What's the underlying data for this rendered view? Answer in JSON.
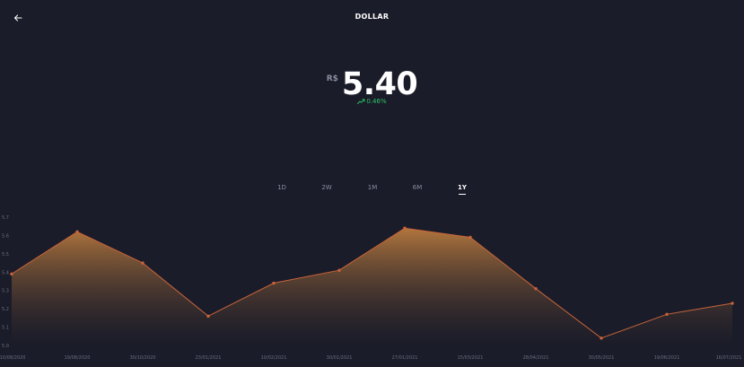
{
  "header": {
    "title": "DOLLAR",
    "back_icon": "arrow-left-icon"
  },
  "quote": {
    "currency": "R$",
    "price": "5.40",
    "change": "0.46%",
    "change_icon": "trend-up-icon",
    "change_color": "#29c466"
  },
  "ranges": [
    {
      "label": "1D",
      "active": false
    },
    {
      "label": "2W",
      "active": false
    },
    {
      "label": "1M",
      "active": false
    },
    {
      "label": "6M",
      "active": false
    },
    {
      "label": "1Y",
      "active": true
    }
  ],
  "chart_data": {
    "type": "area",
    "x": [
      "10/08/2020",
      "19/08/2020",
      "30/10/2020",
      "23/01/2021",
      "10/02/2021",
      "30/01/2021",
      "27/01/2021",
      "15/03/2021",
      "28/04/2021",
      "30/05/2021",
      "19/06/2021",
      "16/07/2021"
    ],
    "values": [
      5.39,
      5.62,
      5.45,
      5.16,
      5.34,
      5.41,
      5.64,
      5.59,
      5.31,
      5.04,
      5.17,
      5.23
    ],
    "ylim": [
      5.0,
      5.7
    ],
    "y_ticks": [
      "5.0",
      "5.1",
      "5.2",
      "5.3",
      "5.4",
      "5.5",
      "5.6",
      "5.7"
    ],
    "line_color": "#c8643a",
    "fill_color": "#b97a3e",
    "grid": false
  }
}
